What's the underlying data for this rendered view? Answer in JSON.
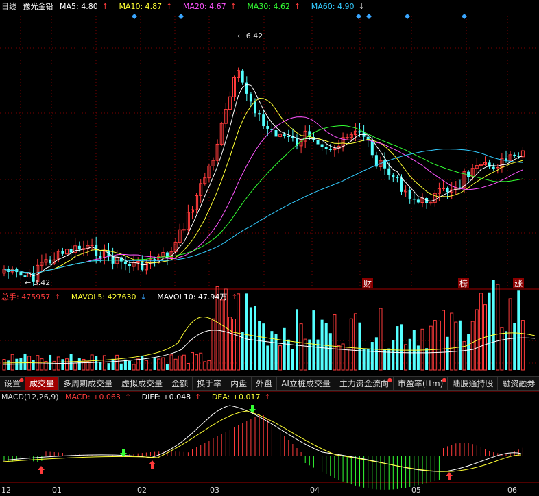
{
  "main_legend": {
    "period": "日线",
    "stock_name": "豫光金铅",
    "ma5": {
      "label": "MA5: 4.80",
      "arrow": "↑",
      "color": "#ffffff"
    },
    "ma10": {
      "label": "MA10: 4.87",
      "arrow": "↑",
      "color": "#ffff33"
    },
    "ma20": {
      "label": "MA20: 4.67",
      "arrow": "↑",
      "color": "#ff55ff"
    },
    "ma30": {
      "label": "MA30: 4.62",
      "arrow": "↑",
      "color": "#33ff33"
    },
    "ma60": {
      "label": "MA60: 4.90",
      "arrow": "↓",
      "color": "#33ccff"
    }
  },
  "price_annotations": {
    "high": "6.42",
    "low": "3.42"
  },
  "event_markers": [
    "财",
    "榜",
    "涨"
  ],
  "vol_legend": {
    "total": {
      "label": "总手: 475957",
      "arrow": "↑",
      "color": "#ff3b3b"
    },
    "mavol5": {
      "label": "MAVOL5: 427630",
      "arrow": "↓",
      "color": "#ffff33"
    },
    "mavol10": {
      "label": "MAVOL10: 47.94万",
      "arrow": "↑",
      "color": "#ffffff"
    }
  },
  "tabs": [
    {
      "label": "设置",
      "active": false,
      "dot": true
    },
    {
      "label": "成交量",
      "active": true,
      "dot": false
    },
    {
      "label": "多周期成交量",
      "active": false,
      "dot": false
    },
    {
      "label": "虚拟成交量",
      "active": false,
      "dot": false
    },
    {
      "label": "金额",
      "active": false,
      "dot": false
    },
    {
      "label": "换手率",
      "active": false,
      "dot": false
    },
    {
      "label": "内盘",
      "active": false,
      "dot": false
    },
    {
      "label": "外盘",
      "active": false,
      "dot": false
    },
    {
      "label": "AI立桩成交量",
      "active": false,
      "dot": false
    },
    {
      "label": "主力资金流向",
      "active": false,
      "dot": true
    },
    {
      "label": "市盈率(ttm)",
      "active": false,
      "dot": true
    },
    {
      "label": "陆股通持股",
      "active": false,
      "dot": false
    },
    {
      "label": "融资融券",
      "active": false,
      "dot": false
    }
  ],
  "macd_legend": {
    "name": {
      "label": "MACD(12,26,9)",
      "color": "#dddddd"
    },
    "macd": {
      "label": "MACD: +0.063",
      "arrow": "↑",
      "color": "#ff3b3b"
    },
    "diff": {
      "label": "DIFF: +0.048",
      "arrow": "↑",
      "color": "#ffffff"
    },
    "dea": {
      "label": "DEA: +0.017",
      "arrow": "↑",
      "color": "#ffff33"
    }
  },
  "time_axis": [
    "12",
    "01",
    "02",
    "03",
    "04",
    "05",
    "06"
  ],
  "colors": {
    "up": "#ff3b3b",
    "down": "#54ffff",
    "grid": "#7a0000",
    "marker": "#3aa6ff"
  }
}
